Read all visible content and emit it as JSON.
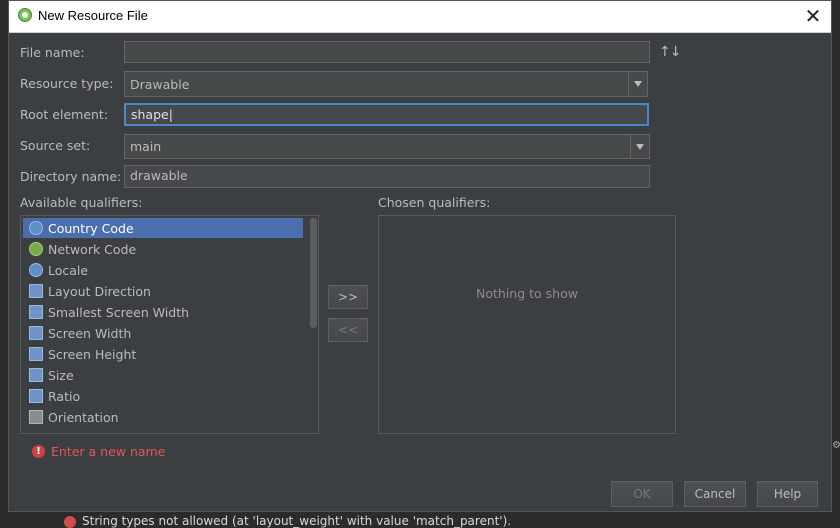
{
  "window": {
    "title": "New Resource File",
    "close_glyph": "✕"
  },
  "form": {
    "file_name_label": "File name:",
    "file_name_value": "",
    "resource_type_label": "Resource type:",
    "resource_type_value": "Drawable",
    "root_element_label": "Root element:",
    "root_element_value": "shape",
    "source_set_label": "Source set:",
    "source_set_value": "main",
    "directory_name_label": "Directory name:",
    "directory_name_value": "drawable",
    "sort_glyph": "↑↓"
  },
  "qualifiers": {
    "available_label": "Available qualifiers:",
    "chosen_label": "Chosen qualifiers:",
    "items": [
      {
        "label": "Country Code",
        "icon": "globe-icon"
      },
      {
        "label": "Network Code",
        "icon": "network-icon"
      },
      {
        "label": "Locale",
        "icon": "globe-icon"
      },
      {
        "label": "Layout Direction",
        "icon": "layout-direction-icon"
      },
      {
        "label": "Smallest Screen Width",
        "icon": "screen-width-icon"
      },
      {
        "label": "Screen Width",
        "icon": "screen-width-icon"
      },
      {
        "label": "Screen Height",
        "icon": "screen-height-icon"
      },
      {
        "label": "Size",
        "icon": "size-icon"
      },
      {
        "label": "Ratio",
        "icon": "ratio-icon"
      },
      {
        "label": "Orientation",
        "icon": "orientation-icon"
      }
    ],
    "add_label": ">>",
    "remove_label": "<<",
    "empty_text": "Nothing to show"
  },
  "error": {
    "message": "Enter a new name",
    "glyph": "!"
  },
  "buttons": {
    "ok": "OK",
    "cancel": "Cancel",
    "help": "Help"
  },
  "background": {
    "status_message": "String types not allowed (at 'layout_weight' with value 'match_parent')."
  }
}
